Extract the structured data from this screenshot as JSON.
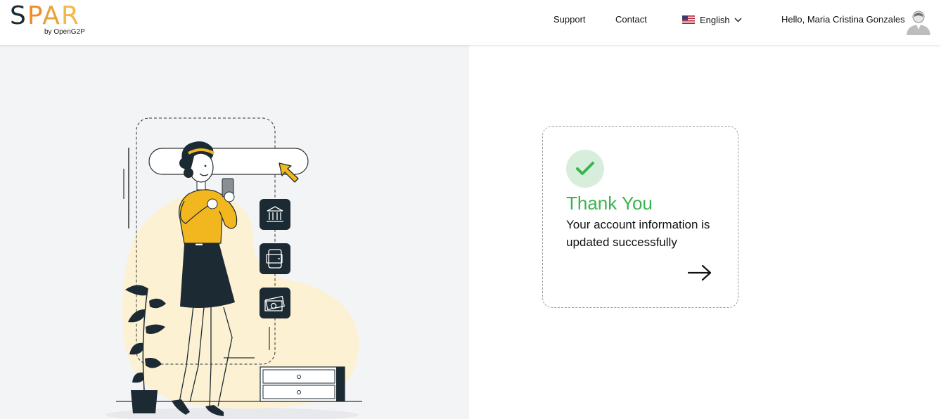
{
  "header": {
    "logo": {
      "letters": [
        "S",
        "P",
        "A",
        "R"
      ],
      "subtitle": "by OpenG2P"
    },
    "nav": {
      "support": "Support",
      "contact": "Contact"
    },
    "language": {
      "selected": "English",
      "flag": "us-flag-icon"
    },
    "greeting": "Hello, Maria Cristina Gonzales",
    "avatar": "user-avatar-icon"
  },
  "card": {
    "icon": "check-icon",
    "title": "Thank You",
    "message": "Your account information is updated successfully",
    "action_icon": "arrow-right-icon"
  },
  "colors": {
    "success": "#3bb34f",
    "success_bg": "#d8eedd",
    "illustration_yellow": "#f2b61f",
    "illustration_dark": "#1b2a33",
    "blob": "#fdf1d3"
  }
}
